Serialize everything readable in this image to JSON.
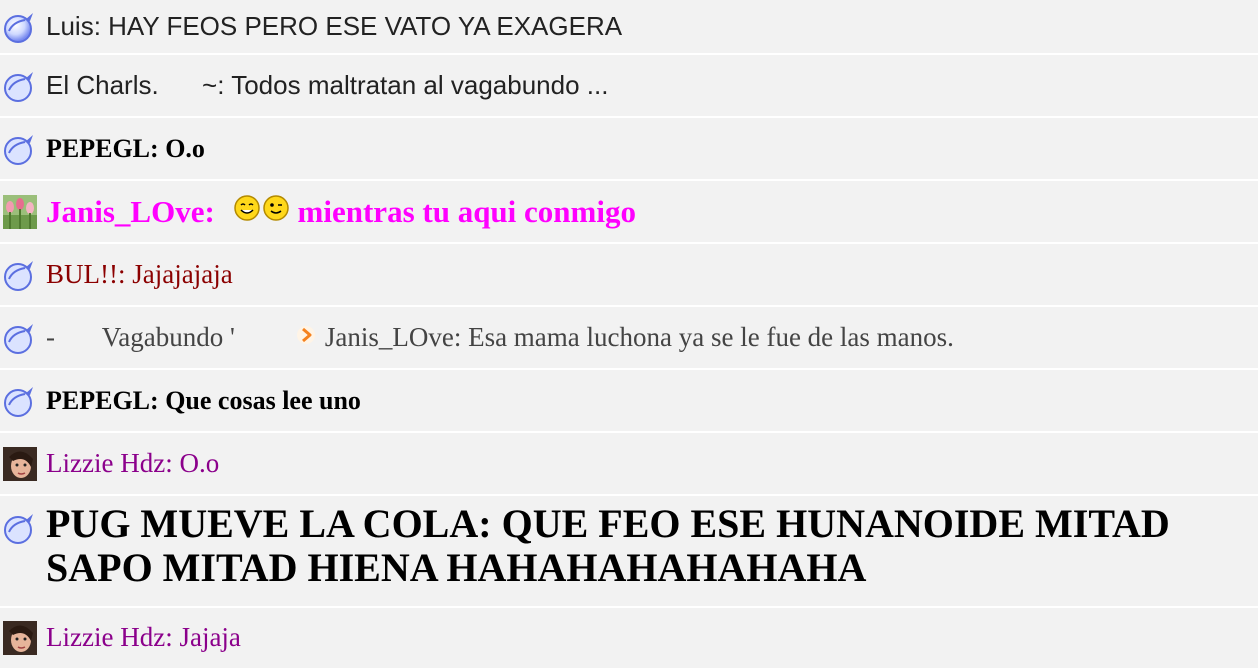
{
  "colors": {
    "background": "#f2f2f2",
    "divider": "#ffffff",
    "default_text": "#222222",
    "magenta": "#ff00ff",
    "dark_red": "#8b0000",
    "purple": "#8b008b",
    "gray": "#444444"
  },
  "messages": [
    {
      "avatar": "default-bubble-avatar",
      "user": "Luis",
      "sep": ": ",
      "text": "HAY FEOS PERO ESE VATO YA EXAGERA"
    },
    {
      "avatar": "default-bubble-avatar",
      "user": "El Charls.      ~",
      "sep": ": ",
      "text": "Todos maltratan al vagabundo ..."
    },
    {
      "avatar": "default-bubble-avatar",
      "user": "PEPEGL",
      "sep": ": ",
      "text": "O.o"
    },
    {
      "avatar": "tulips-avatar",
      "user": "Janis_LOve",
      "sep": ": ",
      "emoticons": [
        "smile-emoticon",
        "wink-emoticon"
      ],
      "text": "mientras tu aqui conmigo"
    },
    {
      "avatar": "default-bubble-avatar",
      "user": "BUL!!",
      "sep": ": ",
      "text": "Jajajajaja"
    },
    {
      "avatar": "default-bubble-avatar",
      "user": "-       Vagabundo '",
      "arrow": "orange-arrow-icon",
      "text": "Janis_LOve: Esa mama luchona ya se le fue de las manos."
    },
    {
      "avatar": "default-bubble-avatar",
      "user": "PEPEGL",
      "sep": ": ",
      "text": "Que cosas lee uno"
    },
    {
      "avatar": "woman-photo-avatar",
      "user": "Lizzie Hdz",
      "sep": ": ",
      "text": "O.o"
    },
    {
      "avatar": "default-bubble-avatar",
      "user": "PUG MUEVE LA COLA",
      "sep": ": ",
      "text": "QUE FEO ESE HUNANOIDE MITAD SAPO MITAD HIENA HAHAHAHAHAHAHA"
    },
    {
      "avatar": "woman-photo-avatar",
      "user": "Lizzie Hdz",
      "sep": ": ",
      "text": "Jajaja"
    }
  ]
}
